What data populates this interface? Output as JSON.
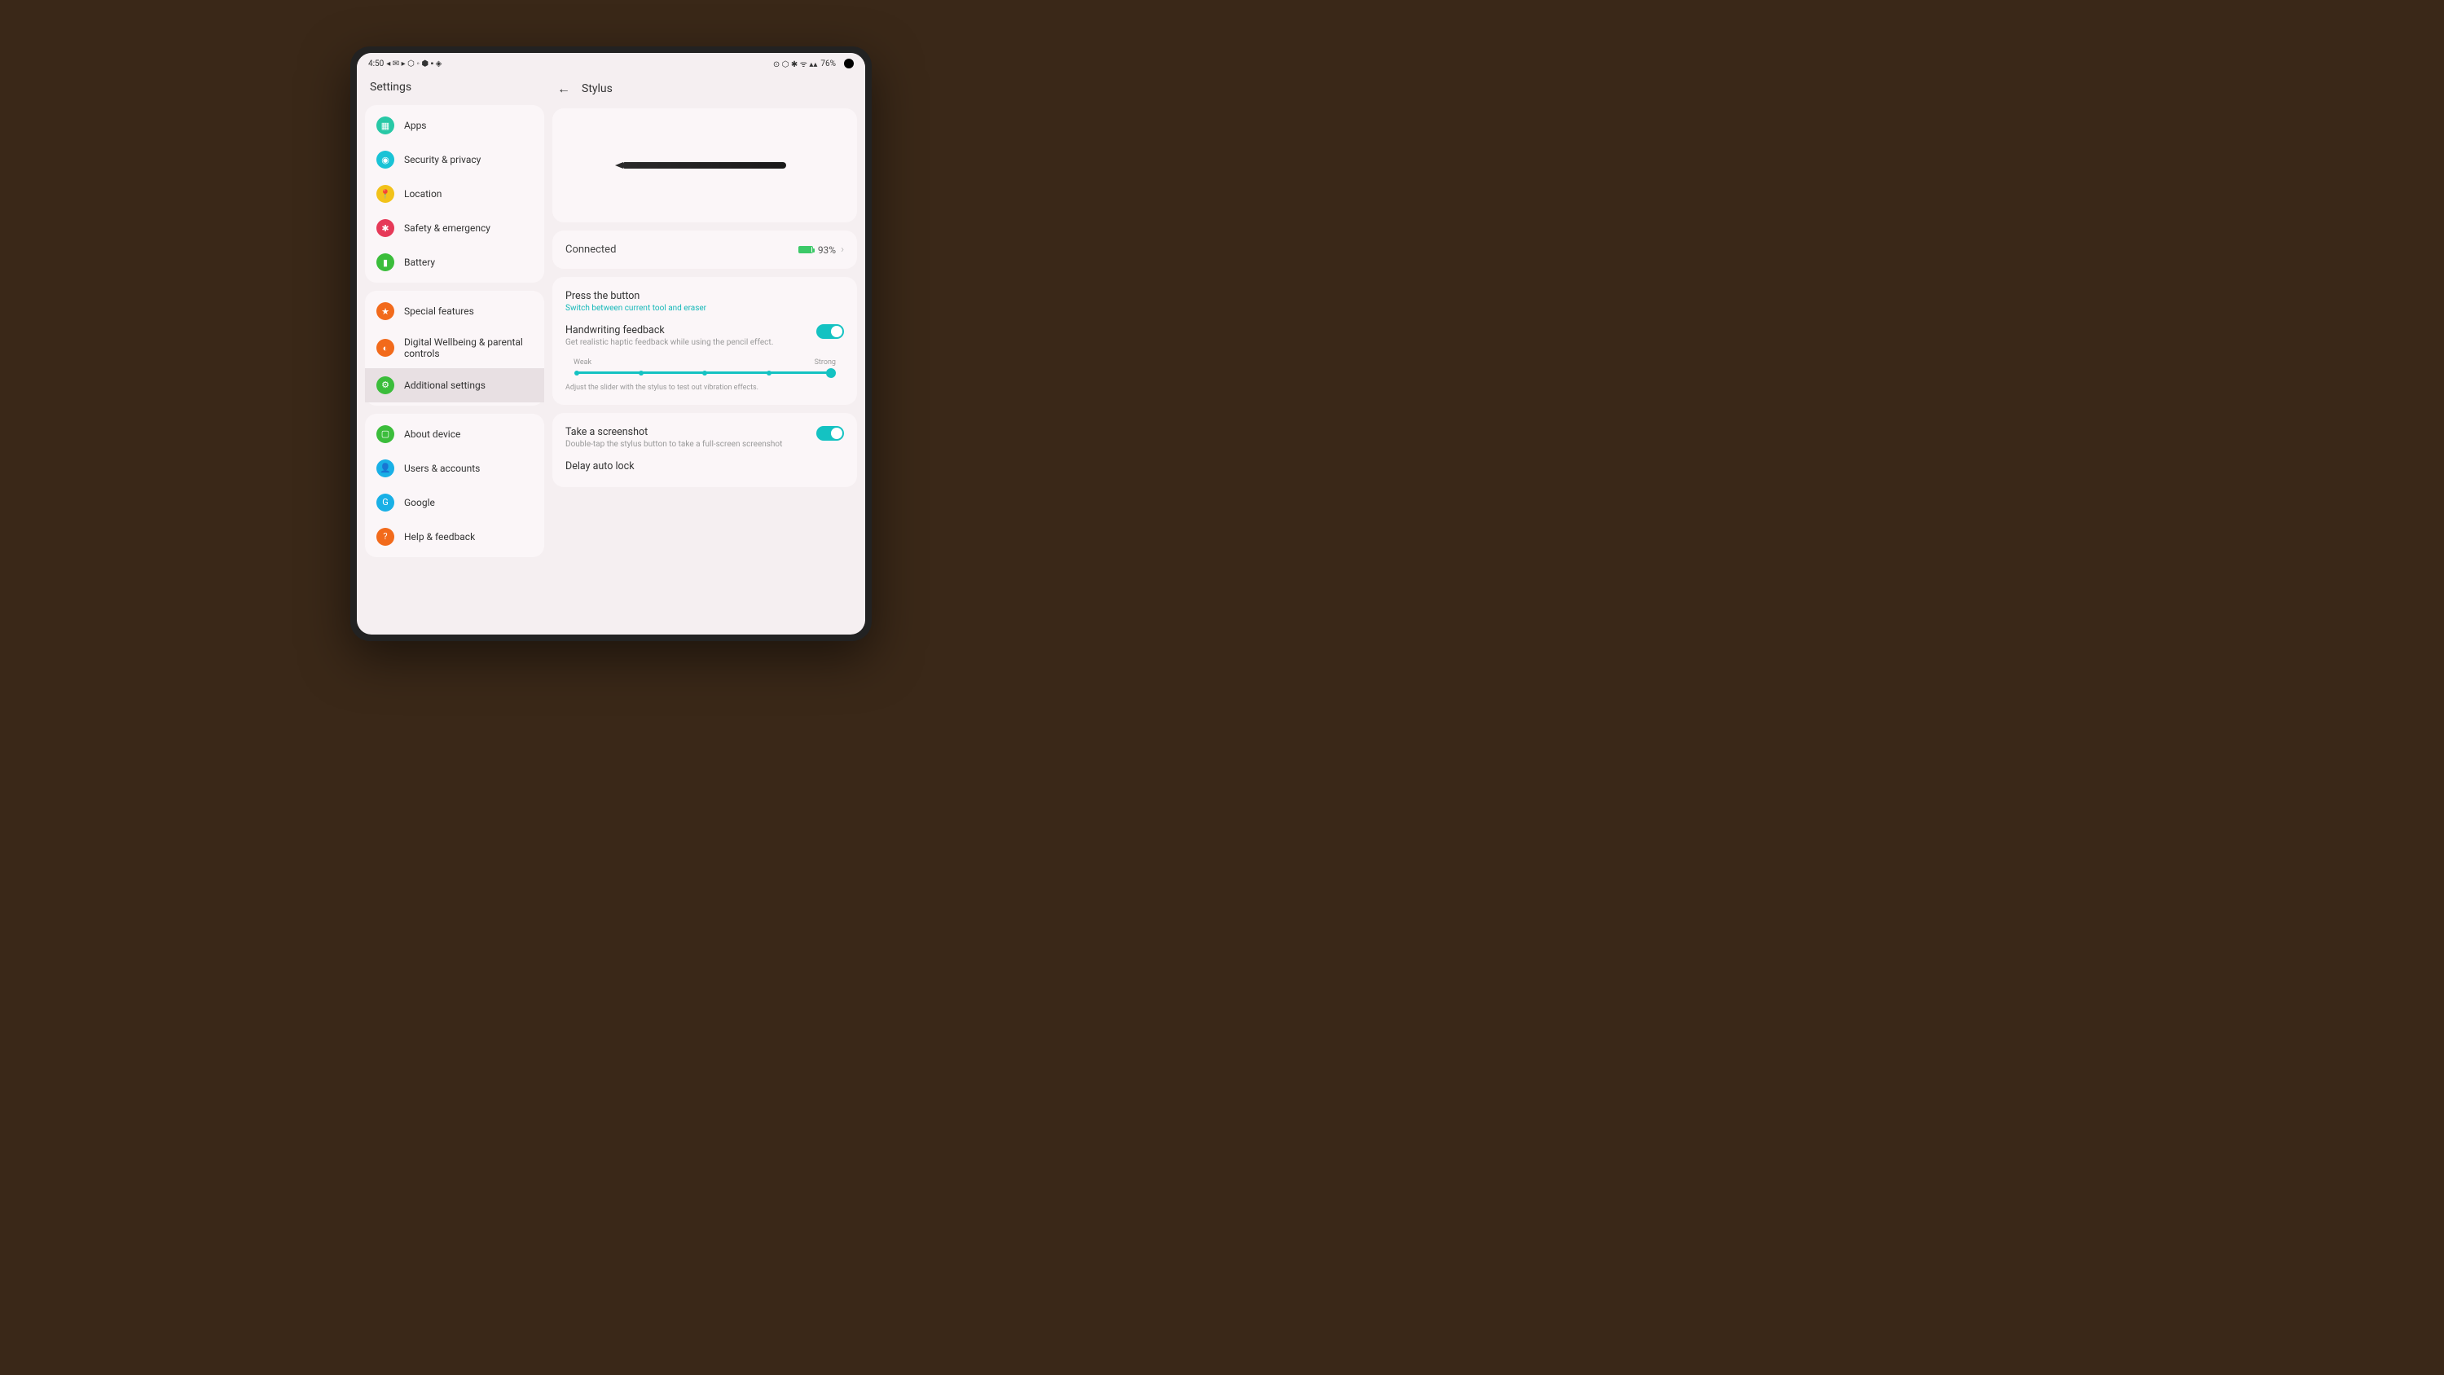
{
  "statusbar": {
    "time": "4:50",
    "battery_percent": "76%"
  },
  "sidebar": {
    "title": "Settings",
    "groups": [
      {
        "items": [
          {
            "label": "Apps",
            "icon": "apps",
            "color": "#28c8a6"
          },
          {
            "label": "Security & privacy",
            "icon": "shield",
            "color": "#19c3d6"
          },
          {
            "label": "Location",
            "icon": "location",
            "color": "#f2c21a"
          },
          {
            "label": "Safety & emergency",
            "icon": "emergency",
            "color": "#e63958"
          },
          {
            "label": "Battery",
            "icon": "battery",
            "color": "#3bbd3b"
          }
        ]
      },
      {
        "items": [
          {
            "label": "Special features",
            "icon": "star",
            "color": "#f26a1b"
          },
          {
            "label": "Digital Wellbeing & parental controls",
            "icon": "wellbeing",
            "color": "#f26a1b"
          },
          {
            "label": "Additional settings",
            "icon": "gear",
            "color": "#3bbd3b",
            "selected": true
          }
        ]
      },
      {
        "items": [
          {
            "label": "About device",
            "icon": "device",
            "color": "#3bbd3b"
          },
          {
            "label": "Users & accounts",
            "icon": "users",
            "color": "#19b0e6"
          },
          {
            "label": "Google",
            "icon": "google",
            "color": "#19b0e6"
          },
          {
            "label": "Help & feedback",
            "icon": "help",
            "color": "#f26a1b"
          }
        ]
      }
    ]
  },
  "detail": {
    "title": "Stylus",
    "connection": {
      "status": "Connected",
      "battery": "93%"
    },
    "press_button": {
      "title": "Press the button",
      "subtitle": "Switch between current tool and eraser"
    },
    "handwriting": {
      "title": "Handwriting feedback",
      "subtitle": "Get realistic haptic feedback while using the pencil effect.",
      "toggle": true,
      "slider_min_label": "Weak",
      "slider_max_label": "Strong",
      "slider_hint": "Adjust the slider with the stylus to test out vibration effects."
    },
    "screenshot": {
      "title": "Take a screenshot",
      "subtitle": "Double-tap the stylus button to take a full-screen screenshot",
      "toggle": true
    },
    "delay_lock": {
      "title": "Delay auto lock"
    }
  },
  "icons": {
    "apps": "▦",
    "shield": "◉",
    "location": "📍",
    "emergency": "✱",
    "battery": "▮",
    "star": "★",
    "wellbeing": "◐",
    "gear": "⚙",
    "device": "▢",
    "users": "👤",
    "google": "G",
    "help": "?"
  }
}
